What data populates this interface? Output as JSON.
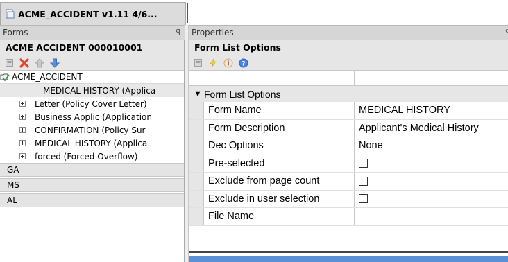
{
  "document_tab": {
    "title": "ACME_ACCIDENT v1.11 4/6..."
  },
  "forms_panel": {
    "header": "Forms",
    "pin_glyph": "ꟼ",
    "title": "ACME  ACCIDENT  000010001",
    "toolbar_icons": [
      "document-icon",
      "delete-icon",
      "move-up-icon",
      "move-down-icon"
    ],
    "tree": {
      "root_label": "ACME_ACCIDENT",
      "items": [
        {
          "label": "MEDICAL HISTORY (Applica",
          "selected": true,
          "expandable": false
        },
        {
          "label": "Letter (Policy Cover Letter)",
          "selected": false,
          "expandable": true
        },
        {
          "label": "Business Applic (Application",
          "selected": false,
          "expandable": true
        },
        {
          "label": "CONFIRMATION (Policy Sur",
          "selected": false,
          "expandable": true
        },
        {
          "label": "MEDICAL HISTORY (Applica",
          "selected": false,
          "expandable": true
        },
        {
          "label": "forced (Forced Overflow)",
          "selected": false,
          "expandable": true
        }
      ],
      "states": [
        "GA",
        "MS",
        "AL"
      ]
    }
  },
  "properties_panel": {
    "header": "Properties",
    "pin_glyph": "ꟼ",
    "title": "Form List Options",
    "toolbar_icons": [
      "document-icon",
      "lightning-icon",
      "info-icon",
      "help-icon"
    ],
    "category": "Form List Options",
    "rows": [
      {
        "name": "Form Name",
        "value": "MEDICAL HISTORY",
        "checkbox": false
      },
      {
        "name": "Form Description",
        "value": "Applicant's Medical History",
        "checkbox": false
      },
      {
        "name": "Dec Options",
        "value": "None",
        "checkbox": false
      },
      {
        "name": "Pre-selected",
        "value": "",
        "checkbox": true
      },
      {
        "name": "Exclude from page count",
        "value": "",
        "checkbox": true
      },
      {
        "name": "Exclude in user selection",
        "value": "",
        "checkbox": true
      },
      {
        "name": "File Name",
        "value": "",
        "checkbox": false
      }
    ]
  }
}
